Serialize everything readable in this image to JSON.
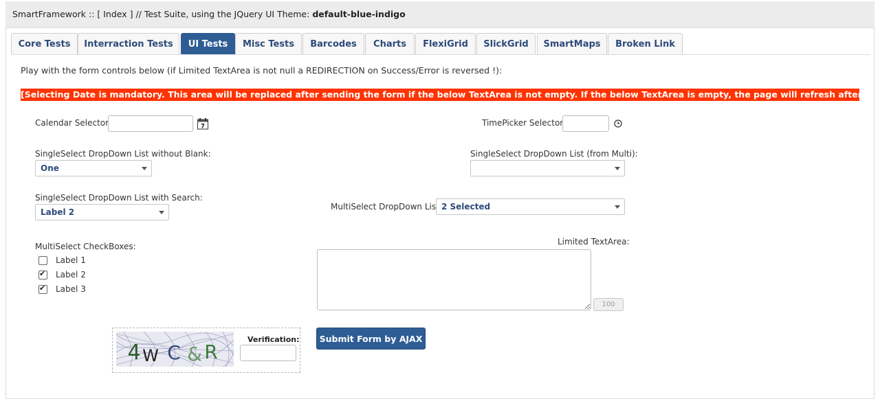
{
  "header": {
    "prefix": "SmartFramework :: [ Index ] // Test Suite, using the JQuery UI Theme: ",
    "theme": "default-blue-indigo"
  },
  "tabs": [
    {
      "label": "Core Tests",
      "active": false
    },
    {
      "label": "Interraction Tests",
      "active": false
    },
    {
      "label": "UI Tests",
      "active": true
    },
    {
      "label": "Misc Tests",
      "active": false
    },
    {
      "label": "Barcodes",
      "active": false
    },
    {
      "label": "Charts",
      "active": false
    },
    {
      "label": "FlexiGrid",
      "active": false
    },
    {
      "label": "SlickGrid",
      "active": false
    },
    {
      "label": "SmartMaps",
      "active": false
    },
    {
      "label": "Broken Link",
      "active": false
    }
  ],
  "intro": "Play with the form controls below (if Limited TextArea is not null a REDIRECTION on Success/Error is reversed !):",
  "alert": "[Selecting Date is mandatory. This area will be replaced after sending the form if the below TextArea is not empty. If the below TextArea is empty, the page will refresh after post !]",
  "colors": {
    "accent": "#2e5d94",
    "alert": "#ff3300",
    "link": "#2d4a7a"
  },
  "form": {
    "calendar_label": "Calendar Selector:",
    "calendar_value": "",
    "calendar_icon_text": "7",
    "timepicker_label": "TimePicker Selector:",
    "timepicker_value": "",
    "single_no_blank_label": "SingleSelect DropDown List without Blank:",
    "single_no_blank_value": "One",
    "single_from_multi_label": "SingleSelect DropDown List (from Multi):",
    "single_from_multi_value": "",
    "single_search_label": "SingleSelect DropDown List with Search:",
    "single_search_value": "Label 2",
    "multi_dropdown_label": "MultiSelect DropDown List:",
    "multi_dropdown_value": "2 Selected",
    "checkboxes_label": "MultiSelect CheckBoxes:",
    "checkboxes": [
      {
        "label": "Label 1",
        "checked": false
      },
      {
        "label": "Label 2",
        "checked": true
      },
      {
        "label": "Label 3",
        "checked": true
      }
    ],
    "textarea_label": "Limited TextArea:",
    "textarea_value": "",
    "textarea_counter": "100",
    "captcha_text": "4 W C &R",
    "verification_label": "Verification:",
    "verification_value": "",
    "submit_label": "Submit Form by AJAX"
  }
}
